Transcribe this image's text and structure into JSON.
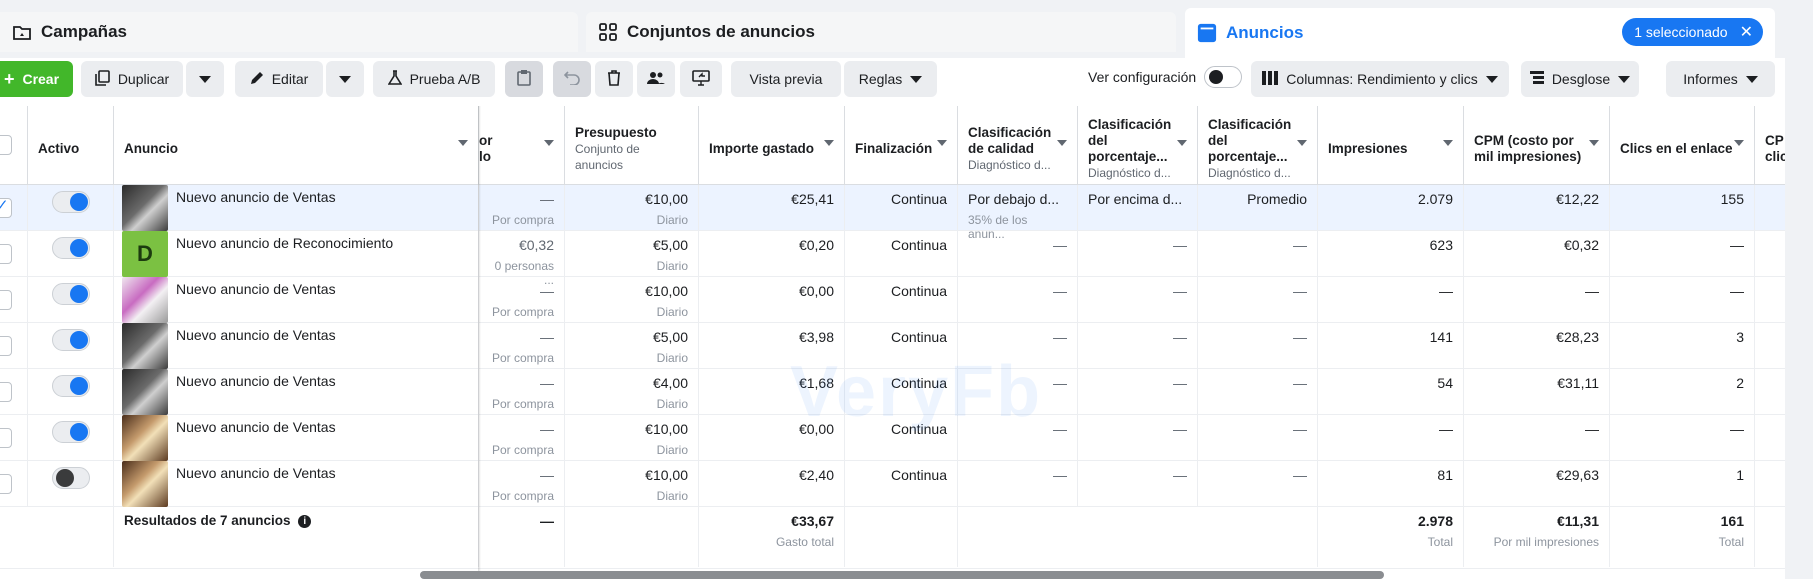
{
  "tabs": {
    "campaigns": "Campañas",
    "adsets": "Conjuntos de anuncios",
    "ads": "Anuncios",
    "selected_badge": "1 seleccionado"
  },
  "toolbar": {
    "create": "Crear",
    "duplicate": "Duplicar",
    "edit": "Editar",
    "ab_test": "Prueba A/B",
    "preview": "Vista previa",
    "rules": "Reglas",
    "view_config": "Ver configuración",
    "columns": "Columnas: Rendimiento y clics",
    "breakdown": "Desglose",
    "reports": "Informes"
  },
  "columns": {
    "active": "Activo",
    "ad": "Anuncio",
    "result_cost_partial": "or",
    "result_cost_partial2": "lo",
    "budget": "Presupuesto",
    "budget_sub": "Conjunto de anuncios",
    "spent": "Importe gastado",
    "end": "Finalización",
    "quality": "Clasificación de calidad",
    "quality_sub": "Diagnóstico d...",
    "engagement": "Clasificación del porcentaje...",
    "engagement_sub": "Diagnóstico d...",
    "conversion": "Clasificación del porcentaje...",
    "conversion_sub": "Diagnóstico d...",
    "impressions": "Impresiones",
    "cpm": "CPM (costo por mil impresiones)",
    "link_clicks": "Clics en el enlace",
    "cpc_partial": "CP",
    "cpc_partial2": "clic"
  },
  "rows": [
    {
      "name": "Nuevo anuncio de Ventas",
      "cost": "—",
      "cost_sub": "Por compra",
      "budget": "€10,00",
      "budget_sub": "Diario",
      "spent": "€25,41",
      "end": "Continua",
      "quality": "Por debajo d...",
      "quality_sub": "35% de los anun...",
      "engagement": "Por encima d...",
      "conversion": "Promedio",
      "impressions": "2.079",
      "cpm": "€12,22",
      "clicks": "155"
    },
    {
      "name": "Nuevo anuncio de Reconocimiento",
      "cost": "€0,32",
      "cost_sub": "0 personas ...",
      "budget": "€5,00",
      "budget_sub": "Diario",
      "spent": "€0,20",
      "end": "Continua",
      "quality": "—",
      "engagement": "—",
      "conversion": "—",
      "impressions": "623",
      "cpm": "€0,32",
      "clicks": "—",
      "thumb_letter": "D"
    },
    {
      "name": "Nuevo anuncio de Ventas",
      "cost": "—",
      "cost_sub": "Por compra",
      "budget": "€10,00",
      "budget_sub": "Diario",
      "spent": "€0,00",
      "end": "Continua",
      "quality": "—",
      "engagement": "—",
      "conversion": "—",
      "impressions": "—",
      "cpm": "—",
      "clicks": "—"
    },
    {
      "name": "Nuevo anuncio de Ventas",
      "cost": "—",
      "cost_sub": "Por compra",
      "budget": "€5,00",
      "budget_sub": "Diario",
      "spent": "€3,98",
      "end": "Continua",
      "quality": "—",
      "engagement": "—",
      "conversion": "—",
      "impressions": "141",
      "cpm": "€28,23",
      "clicks": "3"
    },
    {
      "name": "Nuevo anuncio de Ventas",
      "cost": "—",
      "cost_sub": "Por compra",
      "budget": "€4,00",
      "budget_sub": "Diario",
      "spent": "€1,68",
      "end": "Continua",
      "quality": "—",
      "engagement": "—",
      "conversion": "—",
      "impressions": "54",
      "cpm": "€31,11",
      "clicks": "2"
    },
    {
      "name": "Nuevo anuncio de Ventas",
      "cost": "—",
      "cost_sub": "Por compra",
      "budget": "€10,00",
      "budget_sub": "Diario",
      "spent": "€0,00",
      "end": "Continua",
      "quality": "—",
      "engagement": "—",
      "conversion": "—",
      "impressions": "—",
      "cpm": "—",
      "clicks": "—"
    },
    {
      "name": "Nuevo anuncio de Ventas",
      "cost": "—",
      "cost_sub": "Por compra",
      "budget": "€10,00",
      "budget_sub": "Diario",
      "spent": "€2,40",
      "end": "Continua",
      "quality": "—",
      "engagement": "—",
      "conversion": "—",
      "impressions": "81",
      "cpm": "€29,63",
      "clicks": "1"
    }
  ],
  "totals": {
    "label": "Resultados de 7 anuncios",
    "cost": "—",
    "spent": "€33,67",
    "spent_sub": "Gasto total",
    "impressions": "2.978",
    "impressions_sub": "Total",
    "cpm": "€11,31",
    "cpm_sub": "Por mil impresiones",
    "clicks": "161",
    "clicks_sub": "Total"
  },
  "watermark": "VeryFb",
  "colors": {
    "accent": "#1877f2",
    "create": "#42b72a"
  }
}
